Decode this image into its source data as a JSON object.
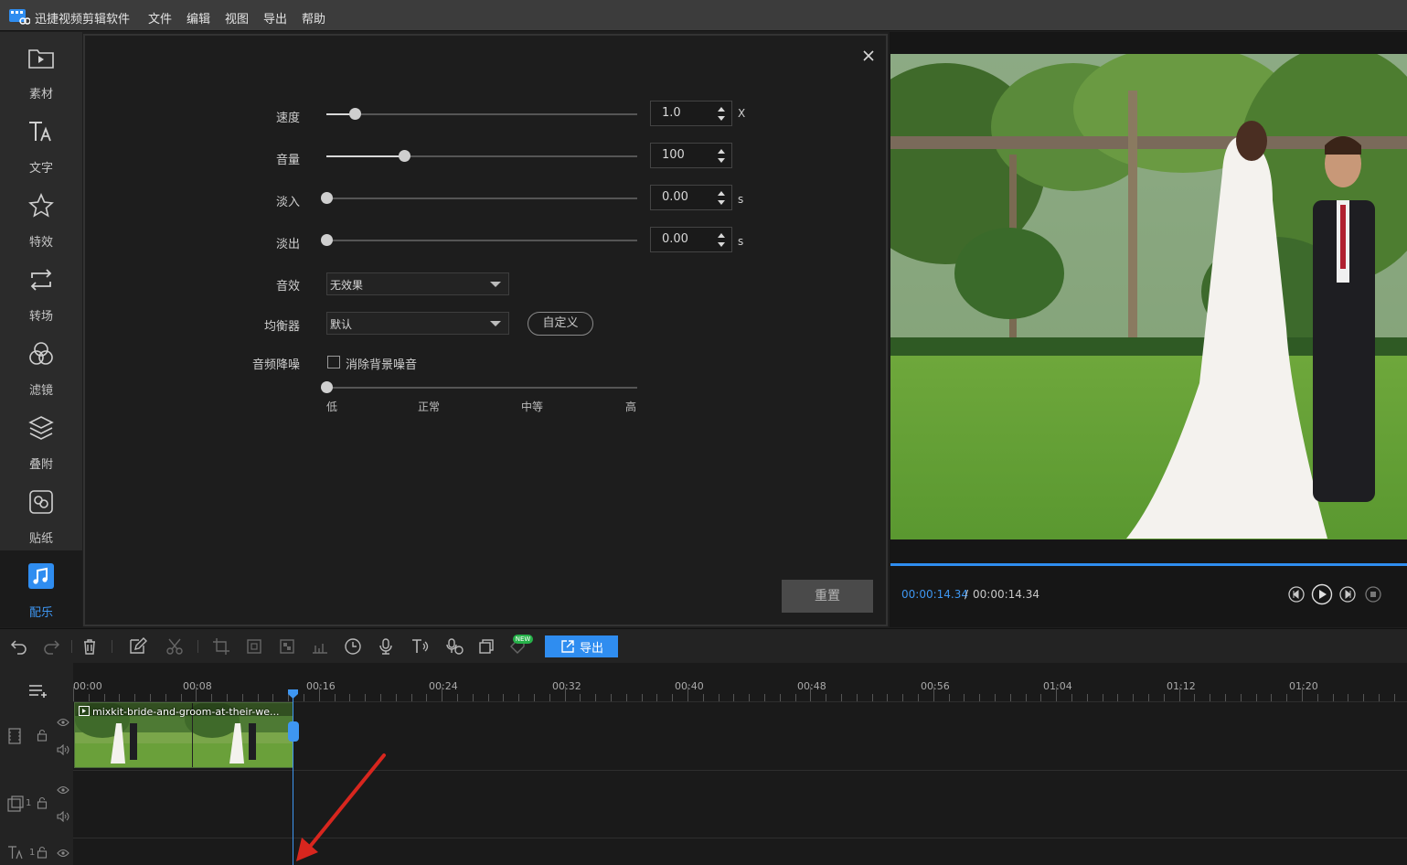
{
  "app": {
    "title": "迅捷视频剪辑软件"
  },
  "menu": [
    "文件",
    "编辑",
    "视图",
    "导出",
    "帮助"
  ],
  "sidebar": {
    "items": [
      {
        "label": "素材",
        "icon": "folder-play-icon"
      },
      {
        "label": "文字",
        "icon": "text-icon"
      },
      {
        "label": "特效",
        "icon": "star-effect-icon"
      },
      {
        "label": "转场",
        "icon": "transition-icon"
      },
      {
        "label": "滤镜",
        "icon": "filter-icon"
      },
      {
        "label": "叠附",
        "icon": "layers-icon"
      },
      {
        "label": "贴纸",
        "icon": "sticker-icon"
      },
      {
        "label": "配乐",
        "icon": "music-icon",
        "active": true
      }
    ]
  },
  "audio_panel": {
    "speed": {
      "label": "速度",
      "value": "1.0",
      "unit": "X",
      "level": 0.09
    },
    "volume": {
      "label": "音量",
      "value": "100",
      "level": 0.25
    },
    "fade_in": {
      "label": "淡入",
      "value": "0.00",
      "unit": "s",
      "level": 0
    },
    "fade_out": {
      "label": "淡出",
      "value": "0.00",
      "unit": "s",
      "level": 0
    },
    "effect": {
      "label": "音效",
      "value": "无效果"
    },
    "equalizer": {
      "label": "均衡器",
      "value": "默认",
      "custom_button": "自定义"
    },
    "denoise": {
      "label": "音频降噪",
      "checkbox_label": "消除背景噪音",
      "checked": false,
      "level": 0,
      "levels": [
        "低",
        "正常",
        "中等",
        "高"
      ]
    },
    "reset_button": "重置"
  },
  "preview": {
    "time_current": "00:00:14.34",
    "time_separator": "/",
    "time_total": "00:00:14.34",
    "accent": "#2f8df0"
  },
  "toolbar": {
    "export_label": "导出",
    "new_badge": "NEW"
  },
  "timeline": {
    "ruler": [
      "00:00",
      "00:08",
      "00:16",
      "00:24",
      "00:32",
      "00:40",
      "00:48",
      "00:56",
      "01:04",
      "01:12",
      "01:20"
    ],
    "clip_name": "mixkit-bride-and-groom-at-their-we...",
    "track_numbers": [
      "1",
      "1"
    ]
  }
}
